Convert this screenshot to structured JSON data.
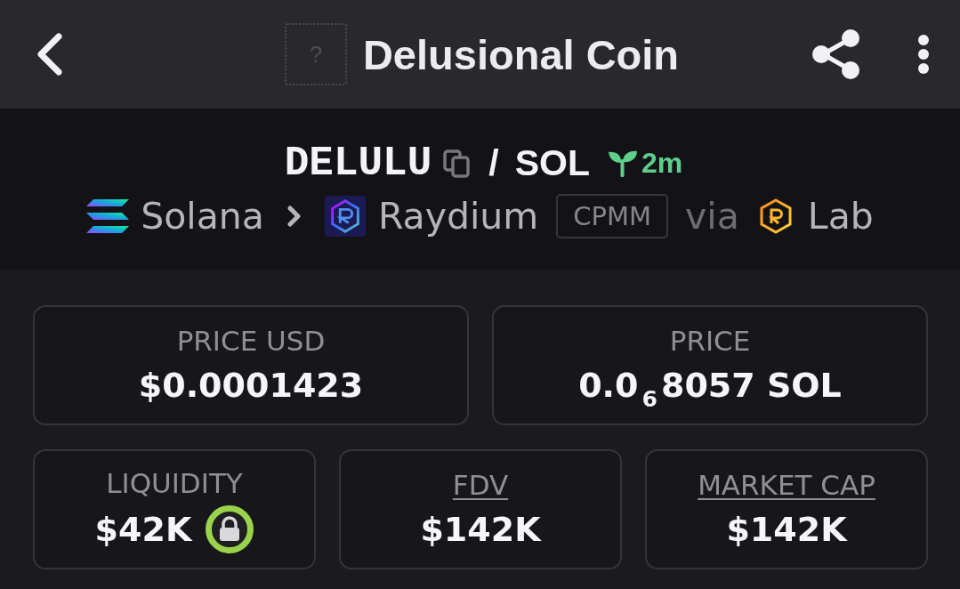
{
  "header": {
    "token_icon": "?",
    "title": "Delusional Coin"
  },
  "pair": {
    "base": "DELULU",
    "separator": "/",
    "quote": "SOL",
    "age": "2m"
  },
  "route": {
    "chain": "Solana",
    "dex": "Raydium",
    "pool_type": "CPMM",
    "via": "via",
    "launchpad": "Lab"
  },
  "prices": [
    {
      "label": "PRICE USD",
      "value": "$0.0001423"
    },
    {
      "label": "PRICE",
      "value": "0.0$_{6}$8057 SOL"
    }
  ],
  "metrics": [
    {
      "label": "LIQUIDITY",
      "value": "$42K",
      "underlined": false,
      "locked": true
    },
    {
      "label": "FDV",
      "value": "$142K",
      "underlined": true,
      "locked": false
    },
    {
      "label": "MARKET CAP",
      "value": "$142K",
      "underlined": true,
      "locked": false
    }
  ]
}
